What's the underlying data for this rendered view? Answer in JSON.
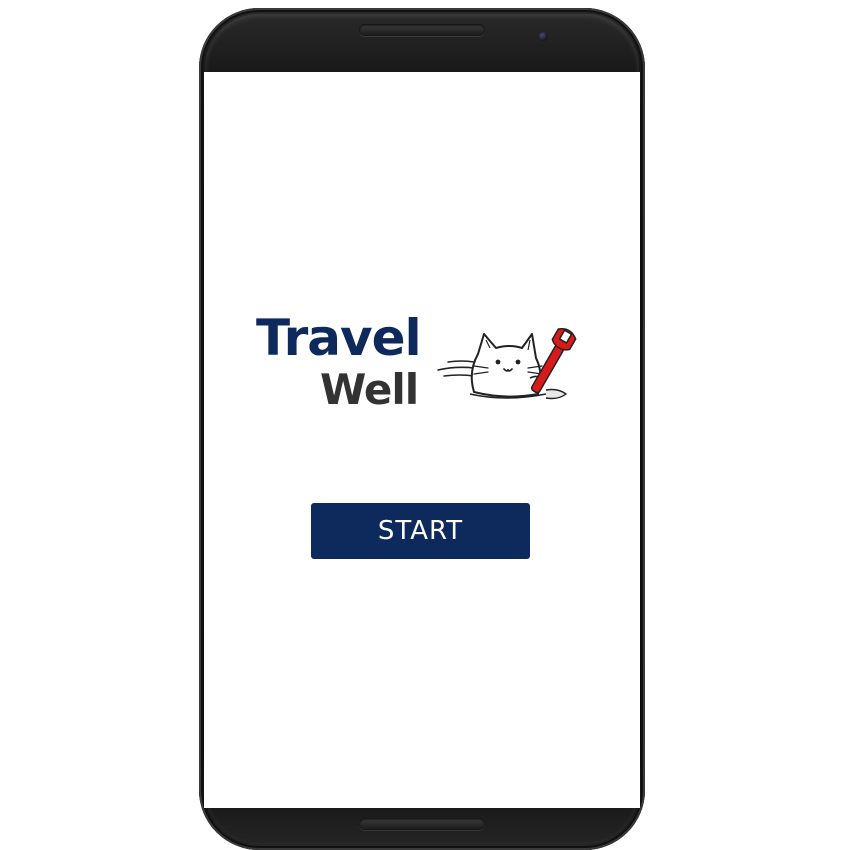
{
  "app": {
    "logo": {
      "line1": "Travel",
      "line2": "Well",
      "mascot_icon": "cat-with-wrench-icon"
    },
    "start_button": {
      "label": "START"
    }
  },
  "colors": {
    "brand_navy": "#0e2a5c",
    "logo_gray": "#333333",
    "wrench_red": "#d91a1a",
    "screen_bg": "#ffffff",
    "phone_body": "#0a0a0a"
  }
}
